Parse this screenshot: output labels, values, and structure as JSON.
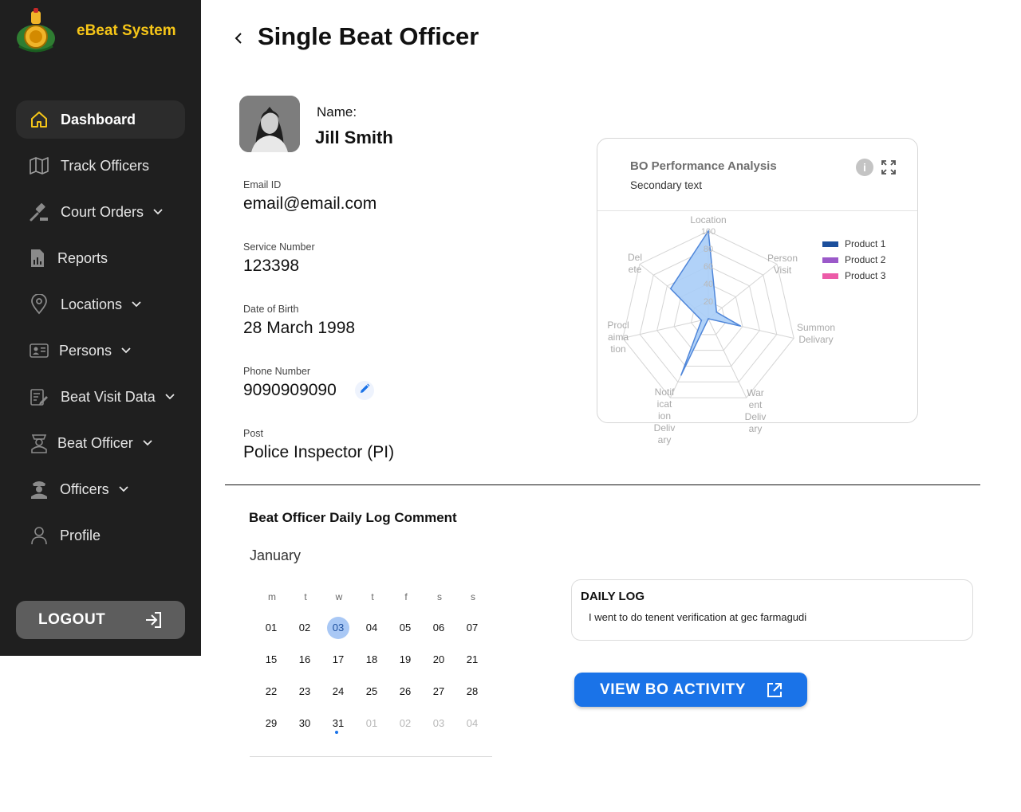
{
  "app": {
    "title": "eBeat System"
  },
  "sidebar": {
    "items": [
      {
        "label": "Dashboard",
        "icon": "home-icon"
      },
      {
        "label": "Track Officers",
        "icon": "map-icon"
      },
      {
        "label": "Court Orders",
        "icon": "gavel-icon"
      },
      {
        "label": "Reports",
        "icon": "report-icon"
      },
      {
        "label": "Locations",
        "icon": "location-pin-icon"
      },
      {
        "label": "Persons",
        "icon": "id-card-icon"
      },
      {
        "label": "Beat Visit Data",
        "icon": "clipboard-edit-icon"
      },
      {
        "label": "Beat Officer",
        "icon": "officer-icon"
      },
      {
        "label": "Officers",
        "icon": "police-officer-icon"
      },
      {
        "label": "Profile",
        "icon": "user-icon"
      }
    ],
    "logout_label": "LOGOUT"
  },
  "header": {
    "title": "Single Beat Officer"
  },
  "officer": {
    "name_label": "Name:",
    "name": "Jill Smith",
    "email_label": "Email ID",
    "email": "email@email.com",
    "service_label": "Service Number",
    "service_number": "123398",
    "dob_label": "Date of Birth",
    "dob": "28 March 1998",
    "phone_label": "Phone Number",
    "phone": "9090909090",
    "post_label": "Post",
    "post": "Police Inspector (PI)"
  },
  "chart_card": {
    "title": "BO Performance Analysis",
    "subtitle": "Secondary text"
  },
  "chart_data": {
    "type": "radar",
    "title": "BO Performance Analysis",
    "subtitle": "Secondary text",
    "axes": [
      [
        "Location"
      ],
      [
        "Person",
        "Visit"
      ],
      [
        "Summon",
        "Delivary"
      ],
      [
        "War",
        "ent",
        "Deliv",
        "ary"
      ],
      [
        "Notif",
        "icat",
        "ion",
        "Deliv",
        "ary"
      ],
      [
        "Procl",
        "aima",
        "tion"
      ],
      [
        "Del",
        "ete"
      ]
    ],
    "radial_ticks": [
      "20",
      "40",
      "60",
      "80",
      "100"
    ],
    "rmax": 100,
    "series": [
      {
        "name": "Product 1",
        "color": "#1b4f9c",
        "values": [
          100,
          12,
          38,
          0,
          72,
          8,
          55
        ]
      },
      {
        "name": "Product 2",
        "color": "#9b59c9",
        "values": []
      },
      {
        "name": "Product 3",
        "color": "#ec5ba8",
        "values": []
      }
    ],
    "fill_color": "#a8cdf7",
    "line_color": "#4f86d9",
    "legend_position": "right"
  },
  "daily_log": {
    "section_title": "Beat Officer Daily Log Comment",
    "month": "January",
    "weekdays": [
      "m",
      "t",
      "w",
      "t",
      "f",
      "s",
      "s"
    ],
    "weeks": [
      [
        "01",
        "02",
        "03",
        "04",
        "05",
        "06",
        "07"
      ],
      [
        "15",
        "16",
        "17",
        "18",
        "19",
        "20",
        "21"
      ],
      [
        "22",
        "23",
        "24",
        "25",
        "26",
        "27",
        "28"
      ],
      [
        "29",
        "30",
        "31",
        "01",
        "02",
        "03",
        "04"
      ]
    ],
    "selected_day": "03",
    "marked_day": "31",
    "card_title": "DAILY LOG",
    "card_text": "I went to do tenent verification at gec farmagudi",
    "button_label": "VIEW BO ACTIVITY"
  }
}
